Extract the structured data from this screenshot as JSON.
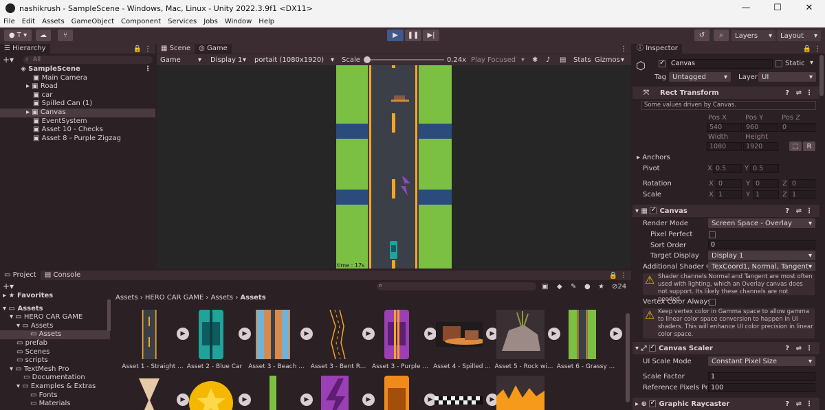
{
  "window": {
    "title": "nashikrush - SampleScene - Windows, Mac, Linux - Unity 2022.3.9f1 <DX11>",
    "minimize": "—",
    "maximize": "☐",
    "close": "✕"
  },
  "menu": [
    "File",
    "Edit",
    "Assets",
    "GameObject",
    "Component",
    "Services",
    "Jobs",
    "Window",
    "Help"
  ],
  "toolbar": {
    "account": "T",
    "layers": "Layers",
    "layout": "Layout"
  },
  "hierarchy": {
    "tab": "Hierarchy",
    "search_placeholder": "All",
    "scene": "SampleScene",
    "items": [
      "Main Camera",
      "Road",
      "car",
      "Spilled Can (1)",
      "Canvas",
      "EventSystem",
      "Asset 10 - Checks",
      "Asset 8 - Purple Zigzag"
    ]
  },
  "game": {
    "tabs": [
      "Scene",
      "Game"
    ],
    "display_mode": "Game",
    "display": "Display 1",
    "resolution": "portait (1080x1920)",
    "scale_label": "Scale",
    "scale_value": "0.24x",
    "play_mode": "Play Focused",
    "stats": "Stats",
    "gizmos": "Gizmos",
    "timer": "time : 17s"
  },
  "project": {
    "tabs": [
      "Project",
      "Console"
    ],
    "hidden_count": "24",
    "breadcrumb": [
      "Assets",
      "HERO CAR GAME",
      "Assets",
      "Assets"
    ],
    "tree": [
      {
        "label": "Favorites",
        "indent": 0,
        "bold": true
      },
      {
        "label": "Assets",
        "indent": 0,
        "bold": true
      },
      {
        "label": "HERO CAR GAME",
        "indent": 1
      },
      {
        "label": "Assets",
        "indent": 2
      },
      {
        "label": "Assets",
        "indent": 3,
        "selected": true
      },
      {
        "label": "prefab",
        "indent": 1
      },
      {
        "label": "Scenes",
        "indent": 1
      },
      {
        "label": "scripts",
        "indent": 1
      },
      {
        "label": "TextMesh Pro",
        "indent": 1
      },
      {
        "label": "Documentation",
        "indent": 2
      },
      {
        "label": "Examples & Extras",
        "indent": 2
      },
      {
        "label": "Fonts",
        "indent": 3
      },
      {
        "label": "Materials",
        "indent": 3
      }
    ],
    "assets_row1": [
      "Asset 1 - Straight ...",
      "Asset 2 - Blue Car",
      "Asset 3 - Beach ...",
      "Asset 3 - Bent R...",
      "Asset 3 - Purple ...",
      "Asset 4 - Spilled ...",
      "Asset 5 - Rock wi...",
      "Asset 6 - Grassy ..."
    ]
  },
  "inspector": {
    "tab": "Inspector",
    "object_name": "Canvas",
    "static_label": "Static",
    "tag_label": "Tag",
    "tag_value": "Untagged",
    "layer_label": "Layer",
    "layer_value": "UI",
    "rect_transform": {
      "title": "Rect Transform",
      "note": "Some values driven by Canvas.",
      "posx_label": "Pos X",
      "posy_label": "Pos Y",
      "posz_label": "Pos Z",
      "posx": "540",
      "posy": "960",
      "posz": "0",
      "width_label": "Width",
      "height_label": "Height",
      "width": "1080",
      "height": "1920",
      "r_button": "R",
      "anchors": "Anchors",
      "pivot": "Pivot",
      "pivot_x": "0.5",
      "pivot_y": "0.5",
      "rotation": "Rotation",
      "rot_x": "0",
      "rot_y": "0",
      "rot_z": "0",
      "scale": "Scale",
      "scale_x": "1",
      "scale_y": "1",
      "scale_z": "1",
      "x": "X",
      "y": "Y",
      "z": "Z"
    },
    "canvas": {
      "title": "Canvas",
      "render_mode_label": "Render Mode",
      "render_mode": "Screen Space - Overlay",
      "pixel_perfect": "Pixel Perfect",
      "sort_order_label": "Sort Order",
      "sort_order": "0",
      "target_display_label": "Target Display",
      "target_display": "Display 1",
      "shader_label": "Additional Shader Ch",
      "shader_value": "TexCoord1, Normal, Tangent",
      "warning1": "Shader channels Normal and Tangent are most often used with lighting, which an Overlay canvas does not support. Its likely these channels are not needed.",
      "vertex_color": "Vertex Color Always",
      "warning2": "Keep vertex color in Gamma space to allow gamma to linear color space conversion to happen in UI shaders. This will enhance UI color precision in linear color space."
    },
    "canvas_scaler": {
      "title": "Canvas Scaler",
      "ui_scale_label": "UI Scale Mode",
      "ui_scale": "Constant Pixel Size",
      "scale_factor_label": "Scale Factor",
      "scale_factor": "1",
      "ref_ppu_label": "Reference Pixels Per",
      "ref_ppu": "100"
    },
    "graphic_raycaster": {
      "title": "Graphic Raycaster"
    }
  },
  "colors": {
    "background": "#2b2024",
    "panel": "#3b2c31",
    "accent": "#3d5a8a",
    "grass": "#7cc043",
    "road": "#3b3f48",
    "water": "#2b4b7c",
    "stripe": "#f5a623"
  }
}
